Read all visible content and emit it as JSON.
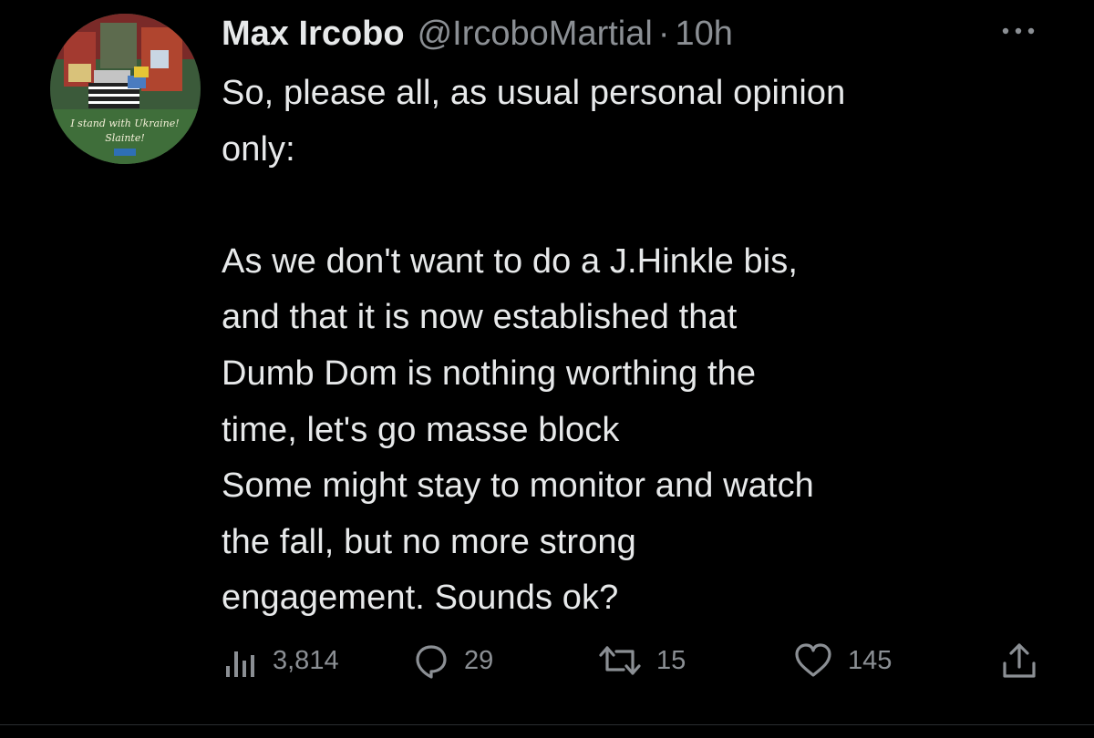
{
  "tweet": {
    "author_name": "Max Ircobo",
    "handle": "@IrcoboMartial",
    "separator": "·",
    "time": "10h",
    "more_icon": "ellipsis-icon",
    "avatar": {
      "caption_line1": "I stand with Ukraine!",
      "caption_line2": "Slainte!"
    },
    "text_lines": [
      "So, please all, as usual personal opinion",
      "only:",
      "",
      "As we don't want to do a J.Hinkle bis,",
      "and that it is now established that",
      "Dumb Dom is nothing worthing the",
      "time, let's go masse block",
      "Some might stay to monitor and watch",
      "the fall, but no more strong",
      "engagement. Sounds ok?"
    ],
    "metrics": {
      "views": "3,814",
      "replies": "29",
      "retweets": "15",
      "likes": "145"
    }
  },
  "colors": {
    "background": "#000000",
    "primary_text": "#e7e9ea",
    "secondary_text": "#8b8f94"
  }
}
